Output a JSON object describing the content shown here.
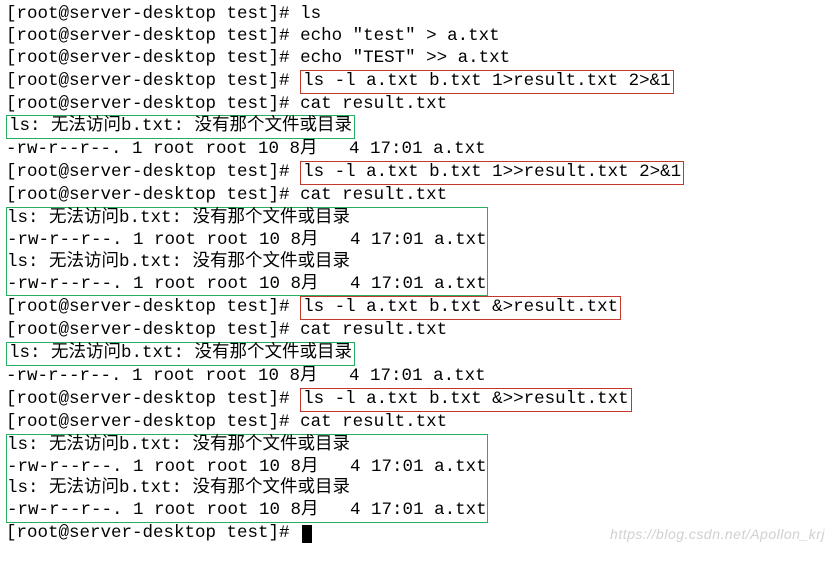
{
  "prompt": "[root@server-desktop test]# ",
  "cmd_ls": "ls",
  "cmd_echo1": "echo \"test\" > a.txt",
  "cmd_echo2": "echo \"TEST\" >> a.txt",
  "cmd_redir1": "ls -l a.txt b.txt 1>result.txt 2>&1",
  "cmd_cat": "cat result.txt",
  "err_btxt": "ls: 无法访问b.txt: 没有那个文件或目录",
  "ls_a": "-rw-r--r--. 1 root root 10 8月   4 17:01 a.txt",
  "cmd_redir2": "ls -l a.txt b.txt 1>>result.txt 2>&1",
  "cmd_redir3": "ls -l a.txt b.txt &>result.txt",
  "cmd_redir4": "ls -l a.txt b.txt &>>result.txt",
  "watermark": "https://blog.csdn.net/Apollon_krj"
}
